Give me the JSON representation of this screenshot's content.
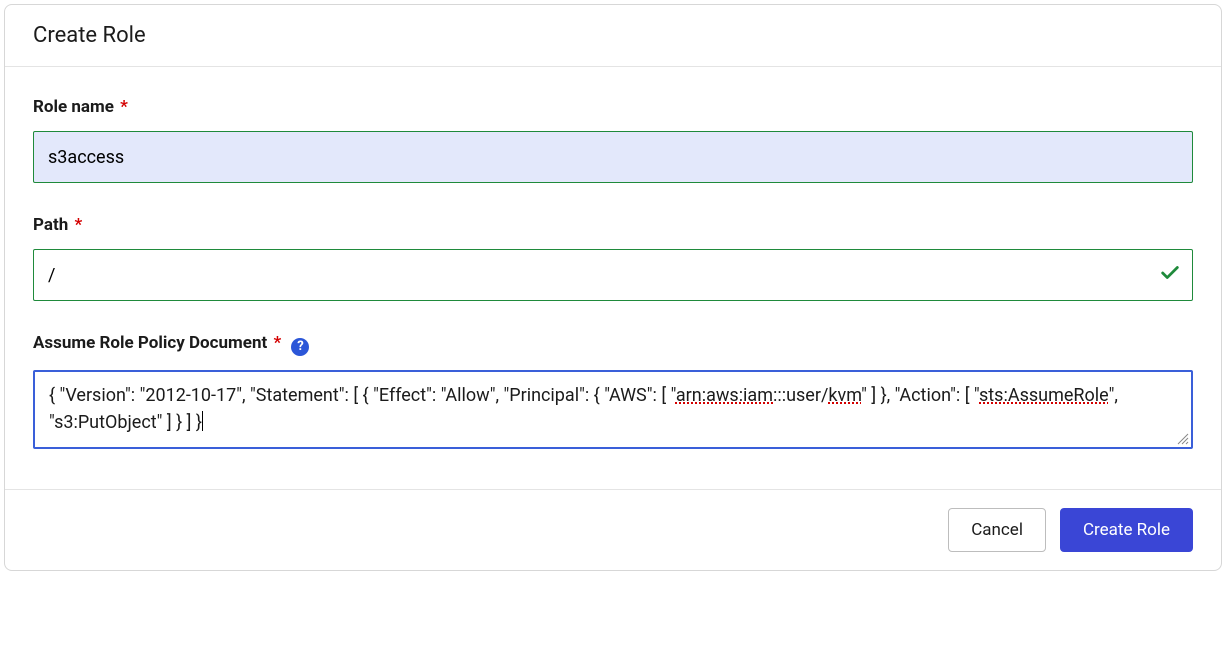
{
  "modal": {
    "title": "Create Role"
  },
  "form": {
    "role_name": {
      "label": "Role name",
      "required_marker": "*",
      "value": "s3access"
    },
    "path": {
      "label": "Path",
      "required_marker": "*",
      "value": "/"
    },
    "policy": {
      "label": "Assume Role Policy Document",
      "required_marker": "*",
      "help_icon": "?",
      "value": "{ \"Version\": \"2012-10-17\", \"Statement\": [ { \"Effect\": \"Allow\", \"Principal\": { \"AWS\": [ \"arn:aws:iam:::user/kvm\" ] }, \"Action\": [ \"sts:AssumeRole\", \"s3:PutObject\" ] } ] }",
      "segments": {
        "a": "{ \"Version\": \"2012-10-17\", \"Statement\": [ { \"Effect\": \"Allow\", \"Principal\": { \"AWS\": [ \"",
        "m1": "arn:aws:iam",
        "b": ":::user/",
        "m2": "kvm",
        "c": "\" ] }, \"Action\": [ \"",
        "m3": "sts:AssumeRole",
        "d": "\", \"s3:PutObject\" ] } ] }"
      }
    }
  },
  "footer": {
    "cancel_label": "Cancel",
    "submit_label": "Create Role"
  }
}
